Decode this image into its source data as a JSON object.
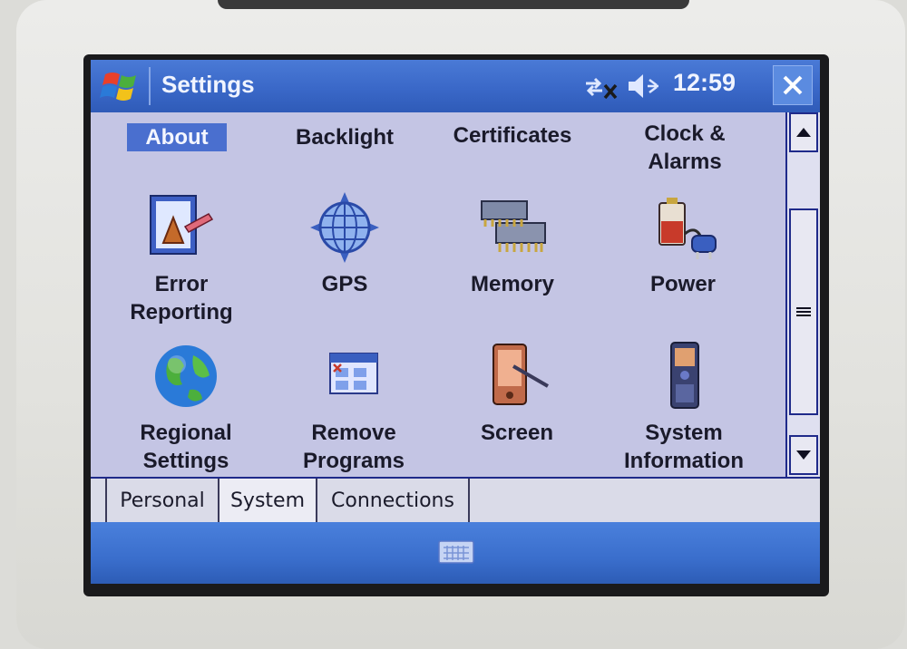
{
  "window": {
    "title": "Settings",
    "time": "12:59"
  },
  "items": [
    {
      "label": "About",
      "icon": "info-icon",
      "selected": true
    },
    {
      "label": "Backlight",
      "icon": "backlight-icon"
    },
    {
      "label": "Certificates",
      "icon": "certificates-icon"
    },
    {
      "label": "Clock &\nAlarms",
      "icon": "clock-icon"
    },
    {
      "label": "Error\nReporting",
      "icon": "error-reporting-icon"
    },
    {
      "label": "GPS",
      "icon": "gps-globe-icon"
    },
    {
      "label": "Memory",
      "icon": "memory-chip-icon"
    },
    {
      "label": "Power",
      "icon": "battery-plug-icon"
    },
    {
      "label": "Regional\nSettings",
      "icon": "globe-icon"
    },
    {
      "label": "Remove\nPrograms",
      "icon": "remove-programs-icon"
    },
    {
      "label": "Screen",
      "icon": "pda-stylus-icon"
    },
    {
      "label": "System\nInformation",
      "icon": "device-info-icon"
    }
  ],
  "tabs": [
    {
      "label": "Personal",
      "active": false
    },
    {
      "label": "System",
      "active": true
    },
    {
      "label": "Connections",
      "active": false
    }
  ],
  "colors": {
    "titlebar": "#3a68c8",
    "content": "#c4c5e4",
    "selection": "#4a6fcf"
  }
}
